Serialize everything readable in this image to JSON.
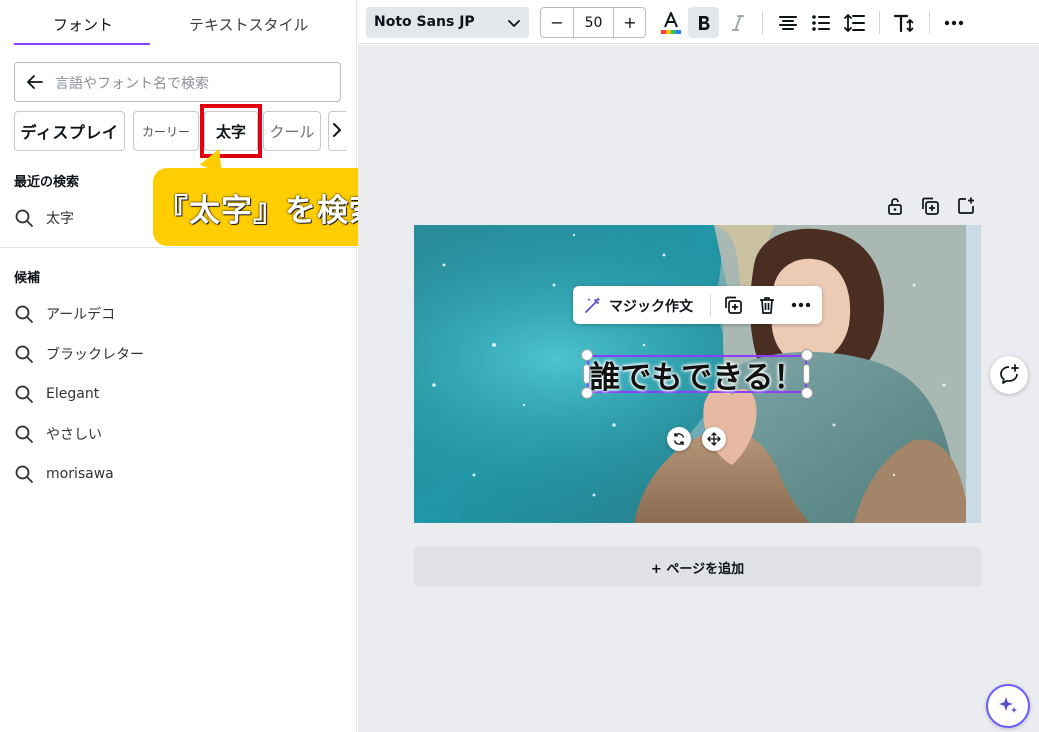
{
  "left_panel": {
    "tabs": [
      {
        "label": "フォント"
      },
      {
        "label": "テキストスタイル"
      }
    ],
    "search": {
      "placeholder": "言語やフォント名で検索"
    },
    "chips": [
      {
        "label": "ディスプレイ"
      },
      {
        "label": "カーリー"
      },
      {
        "label": "太字"
      },
      {
        "label": "クール"
      }
    ],
    "recent": {
      "title": "最近の検索",
      "items": [
        {
          "label": "太字"
        }
      ]
    },
    "suggestions": {
      "title": "候補",
      "items": [
        {
          "label": "アールデコ"
        },
        {
          "label": "ブラックレター"
        },
        {
          "label": "Elegant"
        },
        {
          "label": "やさしい"
        },
        {
          "label": "morisawa"
        }
      ]
    }
  },
  "annotation": {
    "callout_text": "『太字』を検索",
    "highlight_color": "#e00012",
    "callout_color": "#ffcd00"
  },
  "toolbar": {
    "font_name": "Noto Sans JP",
    "font_size": "50",
    "minus": "−",
    "plus": "+"
  },
  "canvas": {
    "magic_write_label": "マジック作文",
    "text_content": "誰でもできる！",
    "add_page_label": "+ ページを追加"
  },
  "colors": {
    "accent": "#8b3dff",
    "toolbar_active": "#e3e6ea",
    "canvas_bg": "#ebecf0"
  }
}
